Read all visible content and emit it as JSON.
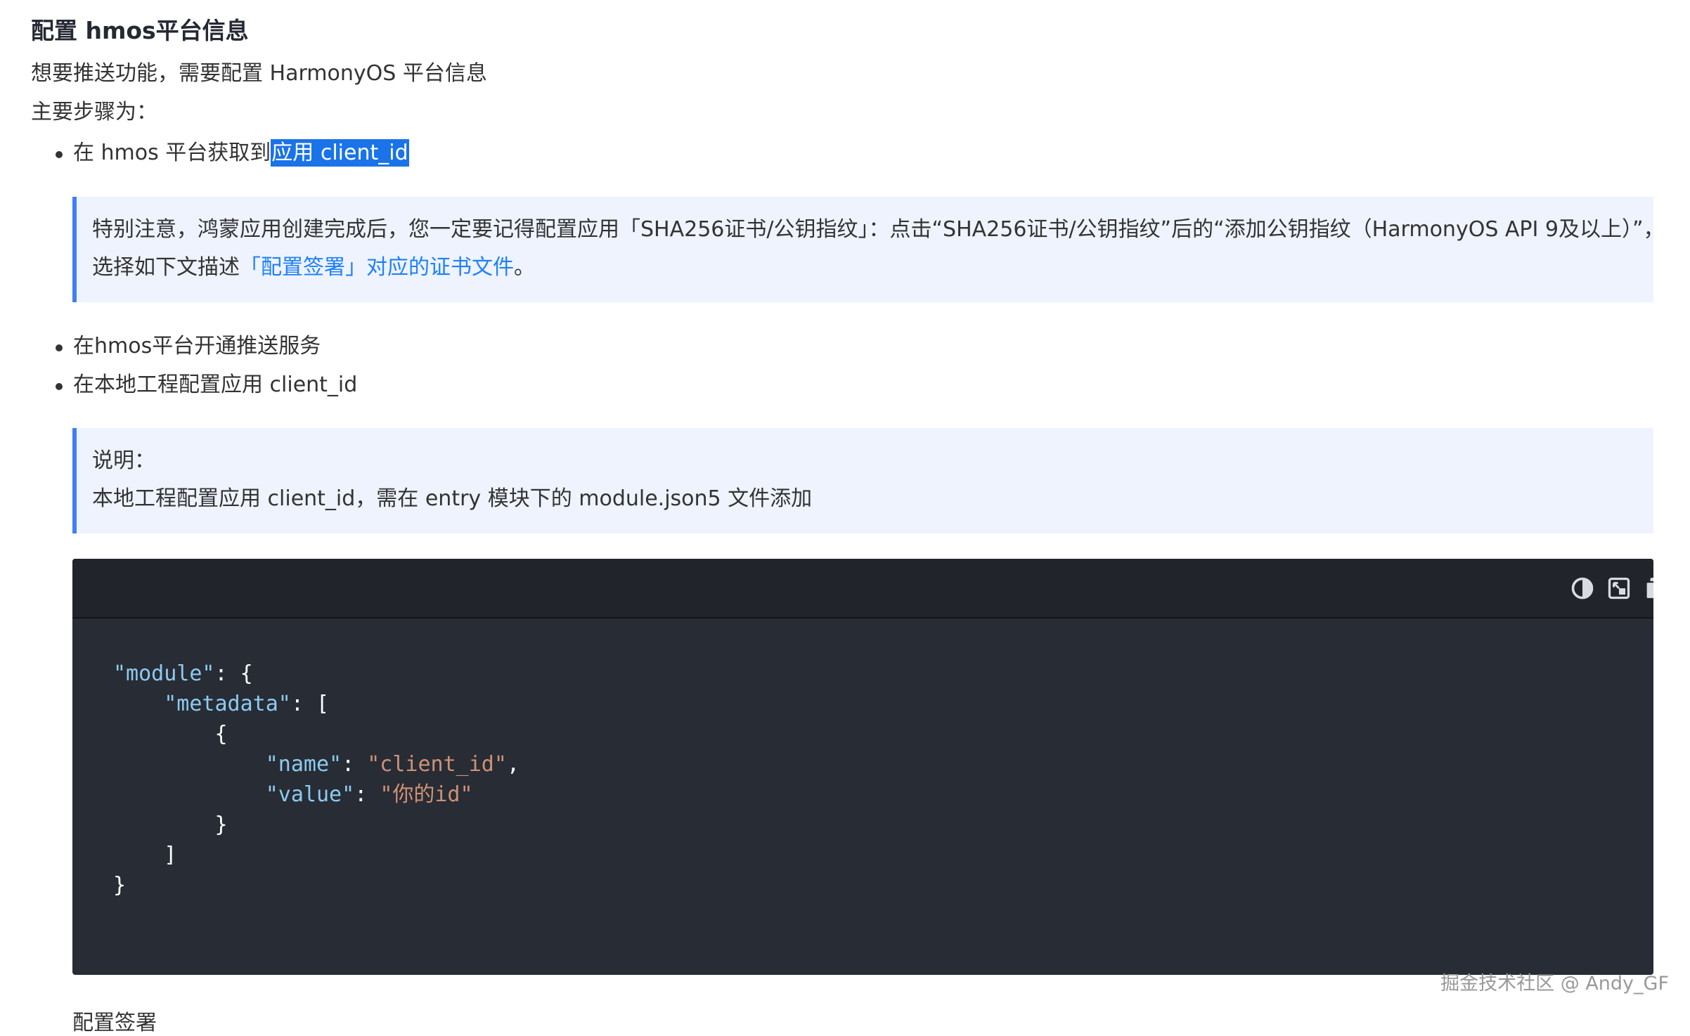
{
  "heading": "配置 hmos平台信息",
  "intro": "想要推送功能，需要配置 HarmonyOS 平台信息",
  "steps_label": "主要步骤为：",
  "bullet1": {
    "text": "在 hmos 平台获取到",
    "highlight": "应用 client_id"
  },
  "note1": {
    "line1": "特别注意，鸿蒙应用创建完成后，您一定要记得配置应用「SHA256证书/公钥指纹」：点击“SHA256证书/公钥指纹”后的“添加公钥指纹（HarmonyOS API 9及以上）”，",
    "line2_prefix": "选择如下文描述",
    "line2_link": "「配置签署」对应的证书文件",
    "line2_suffix": "。"
  },
  "bullet2": "在hmos平台开通推送服务",
  "bullet3": "在本地工程配置应用 client_id",
  "note2": {
    "title": "说明：",
    "text": "本地工程配置应用 client_id，需在 entry 模块下的 module.json5 文件添加"
  },
  "code": {
    "toolbar_icons": [
      "theme-toggle-icon",
      "fullscreen-icon",
      "copy-icon"
    ],
    "lines": {
      "l1_key": "\"module\"",
      "l1_rest": ": {",
      "l2_key": "\"metadata\"",
      "l2_rest": ": [",
      "l3": "{",
      "l4_key": "\"name\"",
      "l4_sep": ": ",
      "l4_val": "\"client_id\"",
      "l4_end": ",",
      "l5_key": "\"value\"",
      "l5_sep": ": ",
      "l5_val": "\"你的id\"",
      "l6": "}",
      "l7": "]",
      "l8": "}"
    }
  },
  "next_heading_partial": "配置签署",
  "watermark": "掘金技术社区 @ Andy_GF",
  "colors": {
    "accent": "#1e80ff",
    "highlight": "#1a73e8",
    "callout_bg": "#eef3fd",
    "callout_border": "#3f7ef5",
    "code_bg": "#282c34"
  }
}
